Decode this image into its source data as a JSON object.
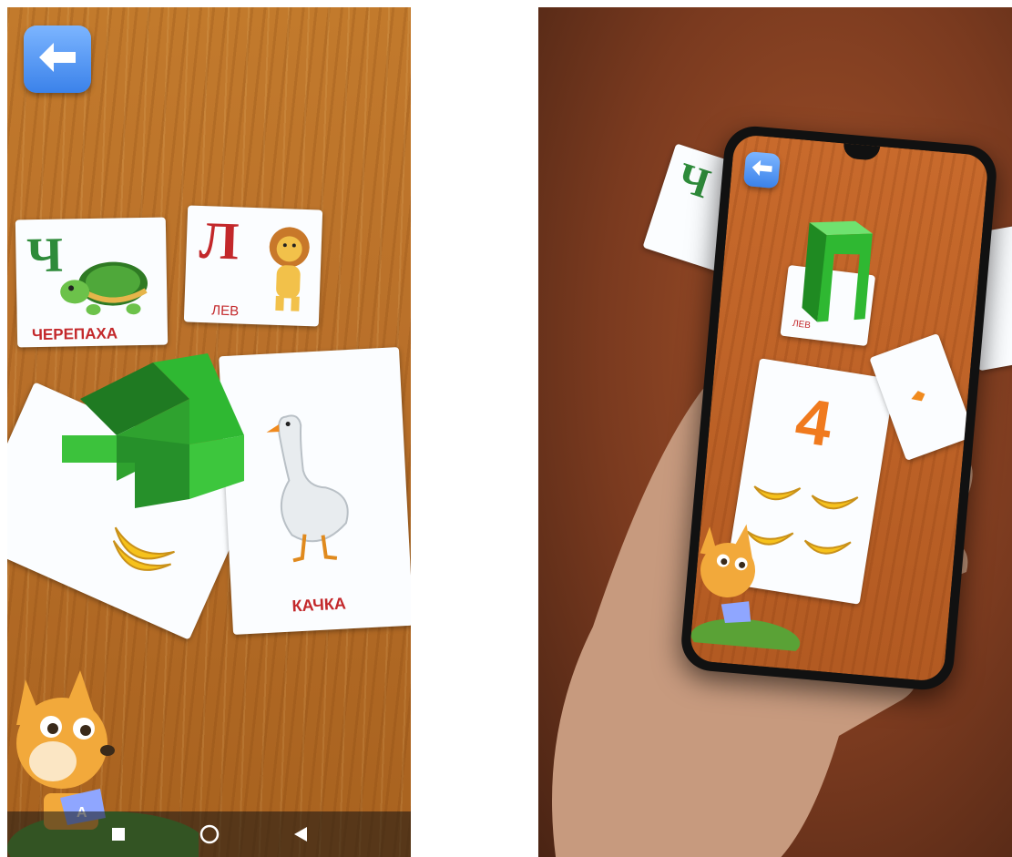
{
  "left_screen": {
    "back_button_icon": "arrow-left-icon",
    "cards": {
      "cherepakha": {
        "letter": "Ч",
        "word": "ЧЕРЕПАХА"
      },
      "lev": {
        "letter": "Л",
        "word": "ЛЕВ"
      },
      "kachka": {
        "word": "КАЧКА"
      }
    },
    "ar_object": "green 3D letter Ч",
    "nav_bar": {
      "icons": [
        "square-icon",
        "circle-icon",
        "triangle-back-icon"
      ]
    }
  },
  "right_screen": {
    "back_button_icon": "arrow-left-icon",
    "ar_object": "green 3D letter Л",
    "number_card": {
      "number": "4",
      "item_count": 4
    },
    "cards": {
      "lev": {
        "word": "ЛЕВ"
      }
    }
  },
  "colors": {
    "accent_blue": "#4a8ff0",
    "ar_green": "#2fb832",
    "number_orange": "#f07a1e",
    "word_red": "#c3282b"
  }
}
